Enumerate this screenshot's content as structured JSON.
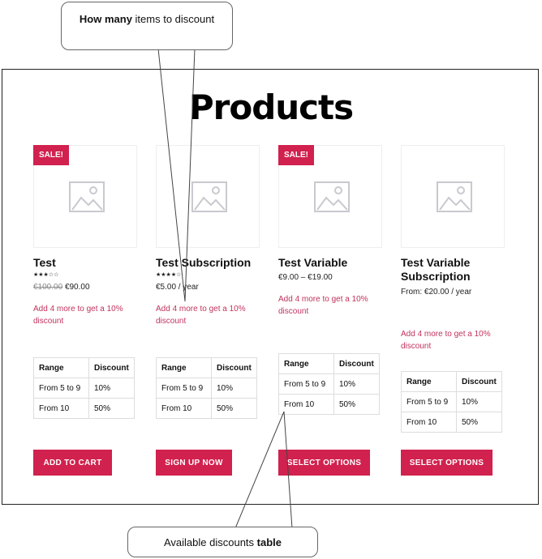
{
  "page": {
    "title": "Products"
  },
  "icons": {
    "placeholder": "image-placeholder-icon",
    "star": "star-icon"
  },
  "colors": {
    "accent": "#d1214e",
    "promo_text": "#c2325e"
  },
  "table_headers": [
    "Range",
    "Discount"
  ],
  "products": [
    {
      "name": "Test",
      "sale_badge": "SALE!",
      "rating": "3 of 5",
      "price_old": "€100.00",
      "price": "€90.00",
      "promo": "Add 4 more to get a 10% discount",
      "rows": [
        [
          "From 5 to 9",
          "10%"
        ],
        [
          "From 10",
          "50%"
        ]
      ],
      "button": "ADD TO CART"
    },
    {
      "name": "Test Subscription",
      "rating": "4 of 5",
      "price": "€5.00 / year",
      "promo": "Add 4 more to get a 10% discount",
      "rows": [
        [
          "From 5 to 9",
          "10%"
        ],
        [
          "From 10",
          "50%"
        ]
      ],
      "button": "SIGN UP NOW"
    },
    {
      "name": "Test Variable",
      "sale_badge": "SALE!",
      "price": "€9.00 – €19.00",
      "promo": "Add 4 more to get a 10% discount",
      "rows": [
        [
          "From 5 to 9",
          "10%"
        ],
        [
          "From 10",
          "50%"
        ]
      ],
      "button": "SELECT OPTIONS"
    },
    {
      "name": "Test Variable Subscription",
      "price": "From: €20.00 / year",
      "promo": "Add 4 more to get a 10% discount",
      "rows": [
        [
          "From 5 to 9",
          "10%"
        ],
        [
          "From 10",
          "50%"
        ]
      ],
      "button": "SELECT OPTIONS"
    }
  ],
  "callouts": {
    "top": {
      "bold": "How many",
      "rest": " items to discount"
    },
    "bottom": {
      "text": "Available discounts ",
      "bold": "table"
    }
  }
}
